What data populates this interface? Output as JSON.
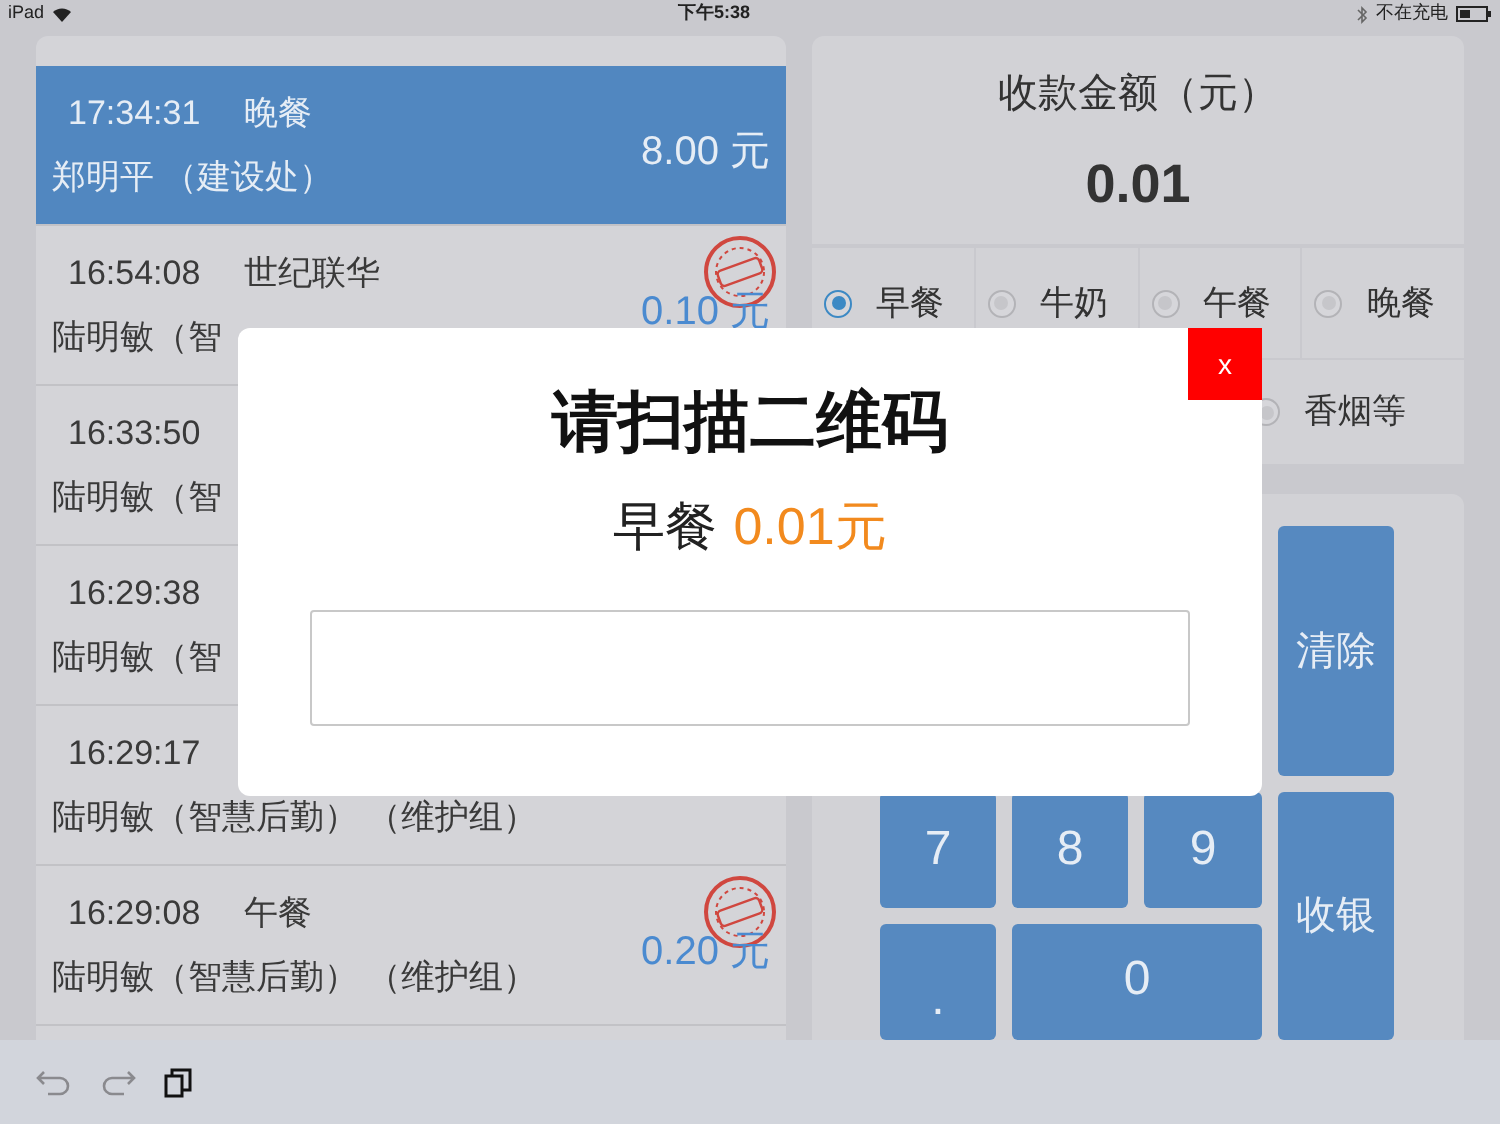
{
  "status_bar": {
    "device": "iPad",
    "time": "下午5:38",
    "battery_text": "不在充电"
  },
  "orders": [
    {
      "time": "17:34:31",
      "meal": "晚餐",
      "name": "郑明平 （建设处）",
      "amount": "8.00 元",
      "selected": true,
      "refunded": false
    },
    {
      "time": "16:54:08",
      "meal": "世纪联华",
      "name": "陆明敏（智",
      "amount": "0.10 元",
      "selected": false,
      "refunded": true
    },
    {
      "time": "16:33:50",
      "name": "陆明敏（智",
      "selected": false,
      "refunded": false
    },
    {
      "time": "16:29:38",
      "name": "陆明敏（智",
      "selected": false,
      "refunded": false
    },
    {
      "time": "16:29:17",
      "name": "陆明敏（智慧后勤） （维护组）",
      "selected": false,
      "refunded": false
    },
    {
      "time": "16:29:08",
      "meal": "午餐",
      "name": "陆明敏（智慧后勤） （维护组）",
      "amount": "0.20 元",
      "selected": false,
      "refunded": true
    }
  ],
  "amount_card": {
    "label": "收款金额（元）",
    "value": "0.01"
  },
  "meal_options": [
    {
      "label": "早餐",
      "selected": true
    },
    {
      "label": "牛奶",
      "selected": false
    },
    {
      "label": "午餐",
      "selected": false
    },
    {
      "label": "晚餐",
      "selected": false
    },
    {
      "label": "香烟等",
      "selected": false
    }
  ],
  "keypad": {
    "clear": "清除",
    "checkout": "收银",
    "keys": [
      "7",
      "8",
      "9",
      ".",
      "0"
    ]
  },
  "dialog": {
    "title": "请扫描二维码",
    "meal": "早餐",
    "price": "0.01元",
    "close": "x"
  }
}
